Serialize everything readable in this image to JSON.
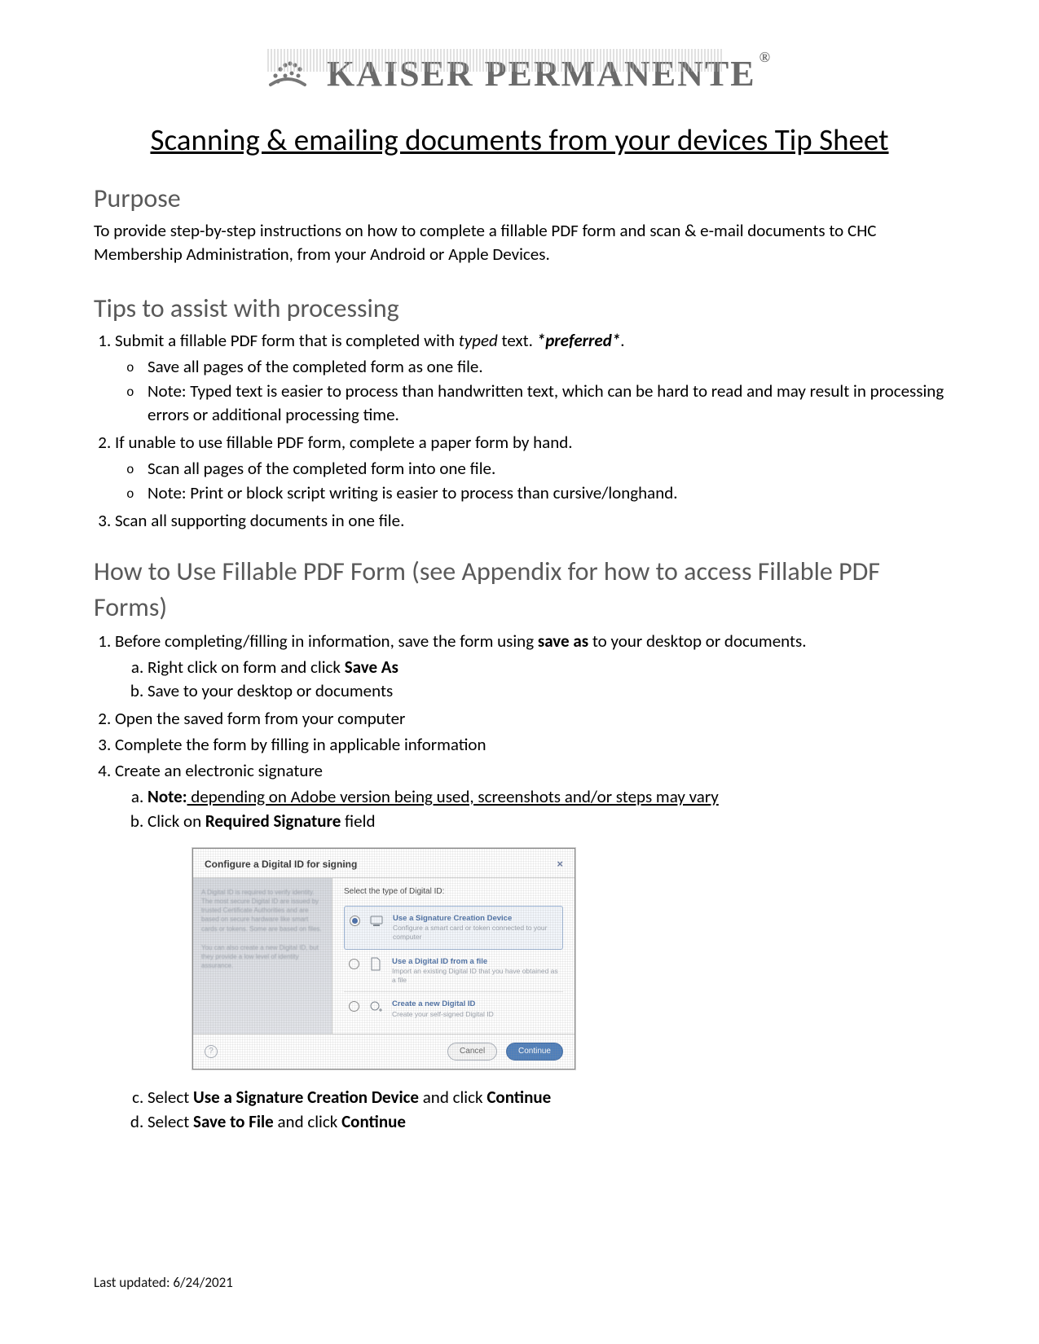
{
  "logo_text": "KAISER PERMANENTE",
  "main_title": "Scanning & emailing documents from your devices Tip Sheet",
  "purpose_heading": "Purpose",
  "purpose_body": "To provide step-by-step instructions on how to complete a fillable PDF form and scan & e-mail documents to CHC Membership Administration, from your Android or Apple Devices.",
  "tips_heading": "Tips to assist with processing",
  "tips": {
    "item1_pre": "Submit a fillable PDF form that is completed with ",
    "item1_typed": "typed",
    "item1_mid": " text. ",
    "item1_pref": "*preferred*",
    "item1_post": ".",
    "item1_sub1": "Save all pages of the completed form as one file.",
    "item1_sub2": "Note: Typed text is easier to process than handwritten text, which can be hard to read and may result in processing errors or additional processing time.",
    "item2": "If unable to use fillable PDF form, complete a paper form by hand.",
    "item2_sub1": "Scan all pages of the completed form into one file.",
    "item2_sub2": "Note: Print or block script writing is easier to process than cursive/longhand.",
    "item3": "Scan all supporting documents in one file."
  },
  "howto_heading": "How to Use Fillable PDF Form (see Appendix for how to access Fillable PDF Forms)",
  "howto": {
    "step1_pre": "Before completing/filling in information, save the form using ",
    "step1_bold": "save as",
    "step1_post": " to your desktop or documents.",
    "step1a_pre": "Right click on form and click ",
    "step1a_bold": "Save As",
    "step1b": "Save to your desktop or documents",
    "step2": "Open the saved form from your computer",
    "step3": "Complete the form by filling in applicable information",
    "step4": "Create an electronic signature",
    "step4a_note_label": "Note:",
    "step4a_note_text": " depending on Adobe version being used, screenshots and/or steps may vary",
    "step4b_pre": "Click on ",
    "step4b_bold": "Required Signature",
    "step4b_post": " field",
    "step4c_pre": "Select ",
    "step4c_bold": "Use a Signature Creation Device",
    "step4c_mid": " and click ",
    "step4c_bold2": "Continue",
    "step4d_pre": "Select ",
    "step4d_bold": "Save to File",
    "step4d_mid": " and click ",
    "step4d_bold2": "Continue"
  },
  "dialog": {
    "title": "Configure a Digital ID for signing",
    "subhead": "Select the type of Digital ID:",
    "side1": "A Digital ID is required to\nverify identity. The\nmost secure Digital ID are\nissued by trusted Certificate\nAuthorities and are based on\nsecure hardware like smart\ncards or tokens. Some are\nbased on files.",
    "side2": "You can also create a new\nDigital ID, but they provide\na low level of identity\nassurance.",
    "opt1_title": "Use a Signature Creation Device",
    "opt1_desc": "Configure a smart card or token connected to your computer",
    "opt2_title": "Use a Digital ID from a file",
    "opt2_desc": "Import an existing Digital ID that you have obtained as a file",
    "opt3_title": "Create a new Digital ID",
    "opt3_desc": "Create your self-signed Digital ID",
    "cancel": "Cancel",
    "continue": "Continue"
  },
  "footer": "Last updated: 6/24/2021"
}
